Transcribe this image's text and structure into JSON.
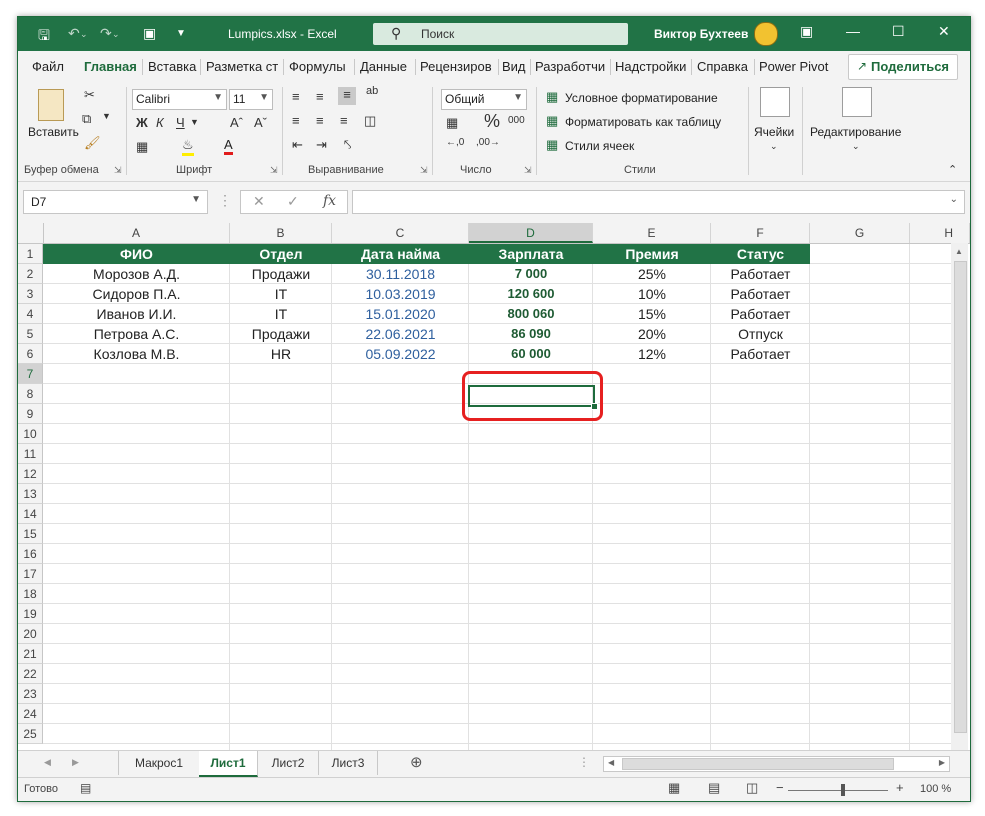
{
  "title_bar": {
    "file_title": "Lumpics.xlsx - Excel",
    "search_placeholder": "Поиск",
    "user_name": "Виктор Бухтеев",
    "qa_icons": [
      "save-icon",
      "undo-icon",
      "redo-icon",
      "camera-icon",
      "customize-icon"
    ]
  },
  "menu_tabs": [
    "Файл",
    "Главная",
    "Вставка",
    "Разметка ст",
    "Формулы",
    "Данные",
    "Рецензиров",
    "Вид",
    "Разработчи",
    "Надстройки",
    "Справка",
    "Power Pivot"
  ],
  "active_tab": "Главная",
  "share_label": "Поделиться",
  "ribbon": {
    "clipboard": {
      "paste_label": "Вставить",
      "group_label": "Буфер обмена"
    },
    "font": {
      "font_name": "Calibri",
      "font_size": "11",
      "bold": "Ж",
      "italic": "К",
      "underline": "Ч",
      "group_label": "Шрифт"
    },
    "alignment": {
      "group_label": "Выравнивание"
    },
    "number": {
      "format": "Общий",
      "group_label": "Число"
    },
    "styles": {
      "conditional": "Условное форматирование",
      "as_table": "Форматировать как таблицу",
      "cell_styles": "Стили ячеек",
      "group_label": "Стили"
    },
    "cells": {
      "label": "Ячейки"
    },
    "editing": {
      "label": "Редактирование"
    }
  },
  "formula_bar": {
    "name_box": "D7",
    "fx": "fx",
    "formula": ""
  },
  "columns": [
    "A",
    "B",
    "C",
    "D",
    "E",
    "F",
    "G",
    "H"
  ],
  "selected_column": "D",
  "rows": [
    "1",
    "2",
    "3",
    "4",
    "5",
    "6",
    "7",
    "8",
    "9",
    "10",
    "11",
    "12",
    "13",
    "14",
    "15",
    "16",
    "17",
    "18",
    "19",
    "20",
    "21",
    "22",
    "23",
    "24",
    "25"
  ],
  "selected_row": "7",
  "table": {
    "headers": [
      "ФИО",
      "Отдел",
      "Дата найма",
      "Зарплата",
      "Премия",
      "Статус"
    ],
    "data": [
      [
        "Морозов А.Д.",
        "Продажи",
        "30.11.2018",
        "7 000",
        "25%",
        "Работает"
      ],
      [
        "Сидоров П.А.",
        "IT",
        "10.03.2019",
        "120 600",
        "10%",
        "Работает"
      ],
      [
        "Иванов И.И.",
        "IT",
        "15.01.2020",
        "800 060",
        "15%",
        "Работает"
      ],
      [
        "Петрова А.С.",
        "Продажи",
        "22.06.2021",
        "86 090",
        "20%",
        "Отпуск"
      ],
      [
        "Козлова М.В.",
        "HR",
        "05.09.2022",
        "60 000",
        "12%",
        "Работает"
      ]
    ]
  },
  "sheet_tabs": [
    "Макрос1",
    "Лист1",
    "Лист2",
    "Лист3"
  ],
  "active_sheet": "Лист1",
  "status": {
    "ready": "Готово",
    "zoom": "100 %",
    "minus": "−",
    "plus": "+"
  },
  "colors": {
    "excel_green": "#217346",
    "highlight_red": "#e62020",
    "date_blue": "#2e5f9e"
  }
}
